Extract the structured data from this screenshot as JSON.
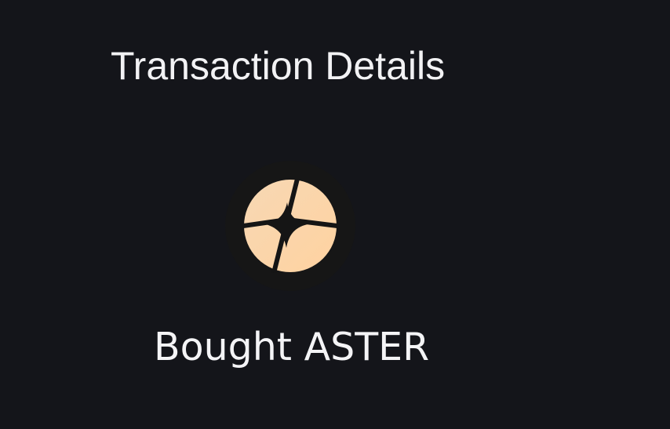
{
  "header": {
    "title": "Transaction Details"
  },
  "transaction": {
    "summary": "Bought ASTER",
    "token_icon": "aster-token-icon"
  },
  "colors": {
    "background": "#14151a",
    "text": "#f2f2f4",
    "token_icon_background": "#161616",
    "token_icon_light": "#f4d7b1",
    "token_icon_dark": "#151515"
  }
}
